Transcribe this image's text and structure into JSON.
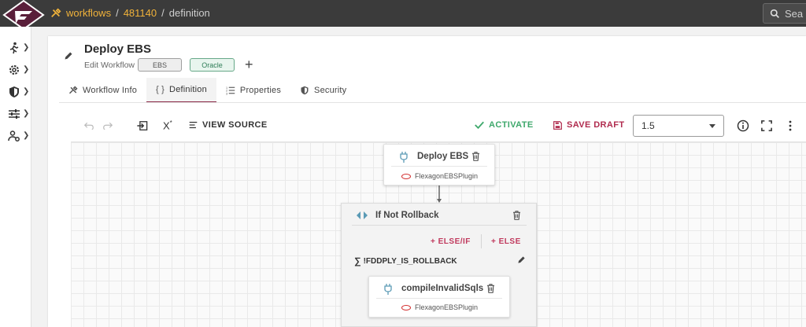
{
  "breadcrumb": {
    "root": "workflows",
    "id": "481140",
    "current": "definition",
    "separator": "/"
  },
  "search": {
    "placeholder": "Sea"
  },
  "workflow": {
    "title": "Deploy EBS",
    "subtitle": "Edit Workflow",
    "tags": [
      "EBS",
      "Oracle"
    ],
    "add_label": "+"
  },
  "tabs": [
    {
      "label": "Workflow Info",
      "icon": "tools-icon"
    },
    {
      "label": "Definition",
      "icon": "braces-icon",
      "active": true
    },
    {
      "label": "Properties",
      "icon": "list-icon"
    },
    {
      "label": "Security",
      "icon": "shield-icon"
    }
  ],
  "toolbar": {
    "superscript_label": "X",
    "view_source": "VIEW SOURCE",
    "activate": "ACTIVATE",
    "save_draft": "SAVE DRAFT",
    "version": "1.5"
  },
  "canvas": {
    "deploy_node": {
      "title": "Deploy EBS",
      "plugin": "FlexagonEBSPlugin"
    },
    "if_node": {
      "title": "If Not Rollback",
      "else_if": "+ ELSE/IF",
      "else": "+ ELSE",
      "condition": "!FDDPLY_IS_ROLLBACK"
    },
    "inner_node": {
      "title": "compileInvalidSqls",
      "plugin": "FlexagonEBSPlugin"
    }
  },
  "colors": {
    "accent": "#8b2947",
    "activate": "#3ea86b",
    "save": "#b02b4e",
    "breadcrumb": "#f0b23a",
    "topbar": "#3b3b3b"
  }
}
